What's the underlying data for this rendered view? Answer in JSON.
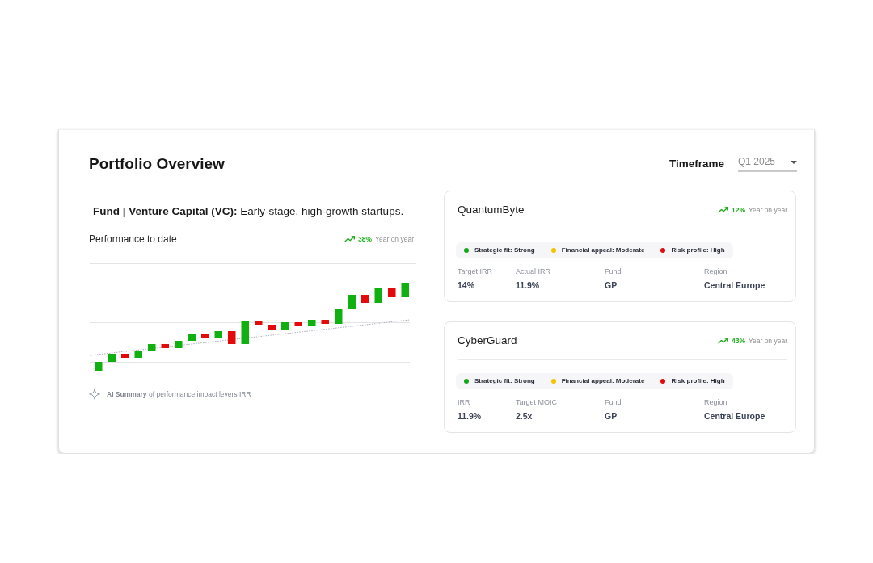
{
  "title": "Portfolio Overview",
  "timeframe": {
    "label": "Timeframe",
    "value": "Q1 2025"
  },
  "fund": {
    "description": "**Fund | Venture Capital (VC):** Early-stage, high-growth startups."
  },
  "performance": {
    "title": "Performance to date",
    "trend": {
      "value": "38%",
      "label": "Year on year"
    },
    "summary": "**AI Summary** of performance impact levers IRR"
  },
  "cards": [
    {
      "name": "QuantumByte",
      "trend": {
        "value": "12%",
        "label": "Year on year"
      },
      "chips": [
        {
          "label": "Strategic fit: Strong",
          "color": "#14a814"
        },
        {
          "label": "Financial appeal: Moderate",
          "color": "#f5c400"
        },
        {
          "label": "Risk profile: High",
          "color": "#e00b0b"
        }
      ],
      "metrics": [
        {
          "label": "Target IRR",
          "value": "14%"
        },
        {
          "label": "Actual IRR",
          "value": "11.9%"
        },
        {
          "label": "Fund",
          "value": "GP"
        },
        {
          "label": "Region",
          "value": "Central Europe"
        }
      ]
    },
    {
      "name": "CyberGuard",
      "trend": {
        "value": "43%",
        "label": "Year on year"
      },
      "chips": [
        {
          "label": "Strategic fit: Strong",
          "color": "#14a814"
        },
        {
          "label": "Financial appeal: Moderate",
          "color": "#f5c400"
        },
        {
          "label": "Risk profile: High",
          "color": "#e00b0b"
        }
      ],
      "metrics": [
        {
          "label": "IRR",
          "value": "11.9%"
        },
        {
          "label": "Target MOIC",
          "value": "2.5x"
        },
        {
          "label": "Fund",
          "value": "GP"
        },
        {
          "label": "Region",
          "value": "Central Europe"
        }
      ]
    }
  ]
}
